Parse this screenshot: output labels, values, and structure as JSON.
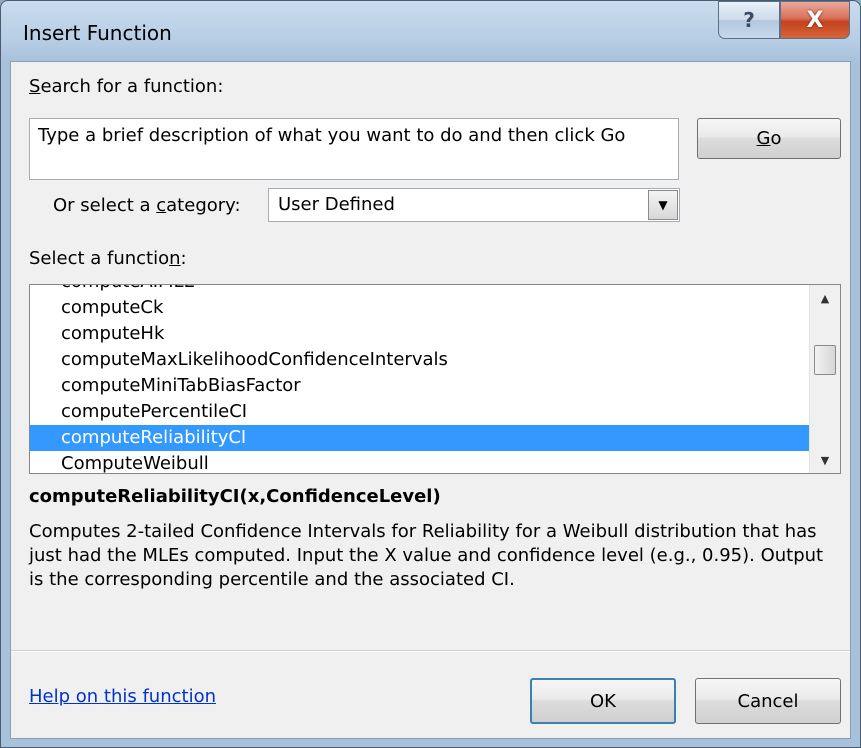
{
  "window": {
    "title": "Insert Function",
    "help_glyph": "?",
    "close_glyph": "X"
  },
  "search": {
    "label_prefix": "",
    "label_key": "S",
    "label_rest": "earch for a function:",
    "input_value": "Type a brief description of what you want to do and then click Go",
    "go_key": "G",
    "go_rest": "o"
  },
  "category": {
    "label_prefix": "Or select a ",
    "label_key": "c",
    "label_rest": "ategory:",
    "selected": "User Defined"
  },
  "function_list": {
    "label_prefix": "Select a functio",
    "label_key": "n",
    "label_rest": ":",
    "items": [
      {
        "label": "computeAIMLE",
        "partial": true,
        "selected": false
      },
      {
        "label": "computeCk",
        "partial": false,
        "selected": false
      },
      {
        "label": "computeHk",
        "partial": false,
        "selected": false
      },
      {
        "label": "computeMaxLikelihoodConfidenceIntervals",
        "partial": false,
        "selected": false
      },
      {
        "label": "computeMiniTabBiasFactor",
        "partial": false,
        "selected": false
      },
      {
        "label": "computePercentileCI",
        "partial": false,
        "selected": false
      },
      {
        "label": "computeReliabilityCI",
        "partial": false,
        "selected": true
      },
      {
        "label": "ComputeWeibull",
        "partial": false,
        "selected": false
      }
    ]
  },
  "details": {
    "signature": "computeReliabilityCI(x,ConfidenceLevel)",
    "description": "Computes 2-tailed Confidence Intervals for Reliability for a Weibull distribution that has just had the MLEs computed.  Input the X value and confidence level (e.g., 0.95).  Output is the corresponding percentile and the associated CI."
  },
  "footer": {
    "help_link": "Help on this function",
    "ok_label": "OK",
    "cancel_label": "Cancel"
  }
}
